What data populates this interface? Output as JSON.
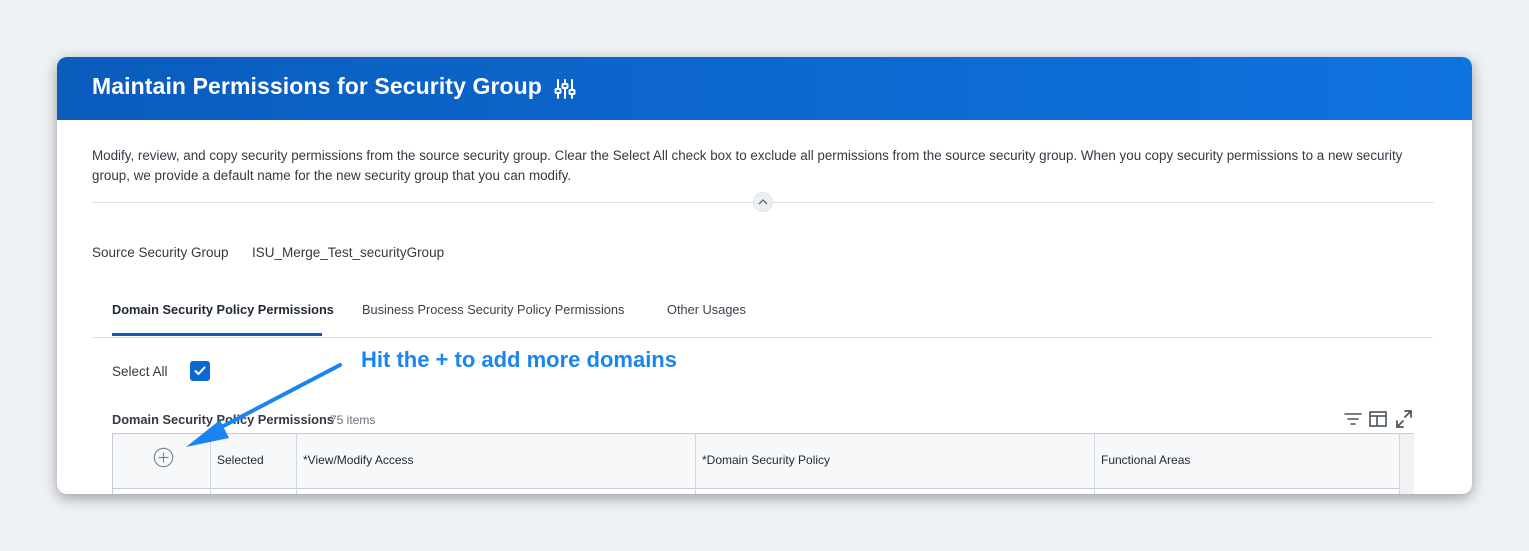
{
  "header": {
    "title": "Maintain Permissions for Security Group",
    "settings_icon": "sliders-icon"
  },
  "description": "Modify, review, and copy security permissions from the source security group. Clear the Select All check box to exclude all permissions from the source security group. When you copy security permissions to a new security group, we provide a default name for the new security group that you can modify.",
  "source_group": {
    "label": "Source Security Group",
    "value": "ISU_Merge_Test_securityGroup"
  },
  "tabs": [
    {
      "label": "Domain Security Policy Permissions",
      "active": true
    },
    {
      "label": "Business Process Security Policy Permissions",
      "active": false
    },
    {
      "label": "Other Usages",
      "active": false
    }
  ],
  "select_all": {
    "label": "Select All",
    "checked": true
  },
  "annotation": "Hit the + to add more domains",
  "table": {
    "title": "Domain Security Policy Permissions",
    "count": "75 items",
    "columns": [
      "Selected",
      "*View/Modify Access",
      "*Domain Security Policy",
      "Functional Areas"
    ],
    "tools": [
      "filter-icon",
      "columns-icon",
      "fullscreen-icon"
    ]
  },
  "colors": {
    "header": "#0a5cbd",
    "accent": "#0a68d4",
    "annotation": "#1a85f0"
  }
}
